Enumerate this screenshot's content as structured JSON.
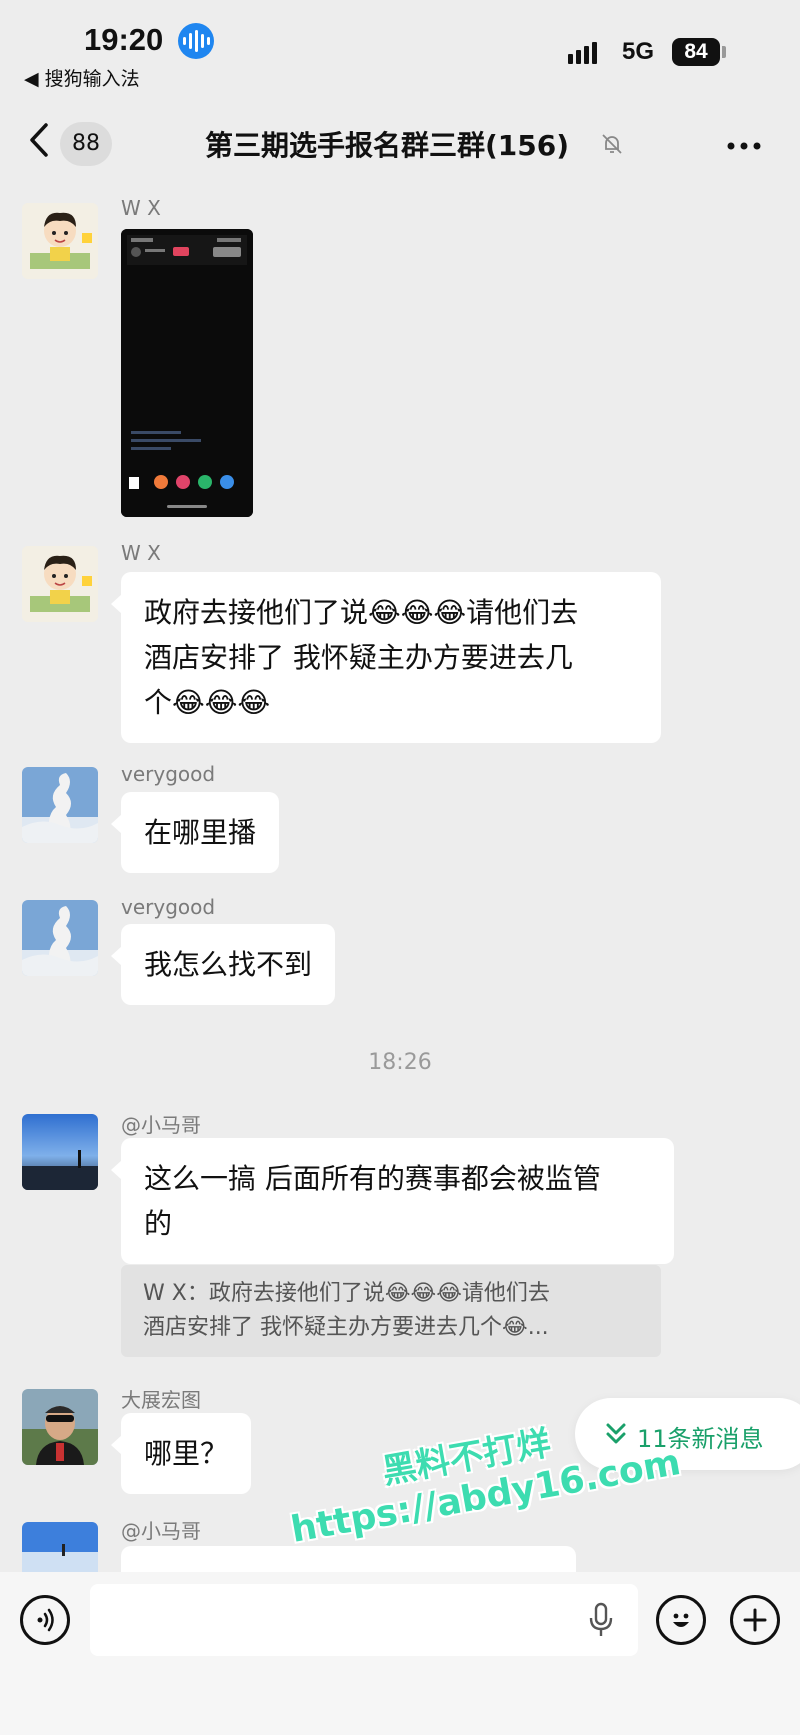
{
  "status_bar": {
    "time": "19:20",
    "back_app": "◀ 搜狗输入法",
    "network": "5G",
    "battery": "84"
  },
  "nav": {
    "back_count": "88",
    "title": "第三期选手报名群三群(156)",
    "icons": [
      "chevron-left-icon",
      "bell-muted-icon",
      "more-icon"
    ]
  },
  "messages": [
    {
      "sender": "W   X",
      "type": "image"
    },
    {
      "sender": "W   X",
      "lines": [
        "政府去接他们了说😂😂😂请他们去",
        "酒店安排了  我怀疑主办方要进去几",
        "个😂😂😂"
      ]
    },
    {
      "sender": "verygood",
      "lines": [
        "在哪里播"
      ]
    },
    {
      "sender": "verygood",
      "lines": [
        "我怎么找不到"
      ]
    },
    {
      "sender": "@小马哥",
      "lines": [
        "这么一搞 后面所有的赛事都会被监管",
        "的"
      ],
      "quote": [
        "W   X：政府去接他们了说😂😂😂请他们去",
        "酒店安排了  我怀疑主办方要进去几个😂..."
      ]
    },
    {
      "sender": "大展宏图",
      "lines": [
        "哪里？"
      ]
    },
    {
      "sender": "@小马哥",
      "lines": []
    }
  ],
  "time_separator": "18:26",
  "new_messages_label": "11条新消息",
  "watermark": {
    "line1": "黑料不打烊",
    "line2": "https://abdy16.com"
  },
  "input_bar": {
    "icons": [
      "voice-icon",
      "mic-icon",
      "emoji-icon",
      "plus-icon"
    ]
  },
  "colors": {
    "background": "#ededed",
    "bubble": "#ffffff",
    "accent_green": "#1aa06a",
    "watermark": "#3ddcb0"
  }
}
